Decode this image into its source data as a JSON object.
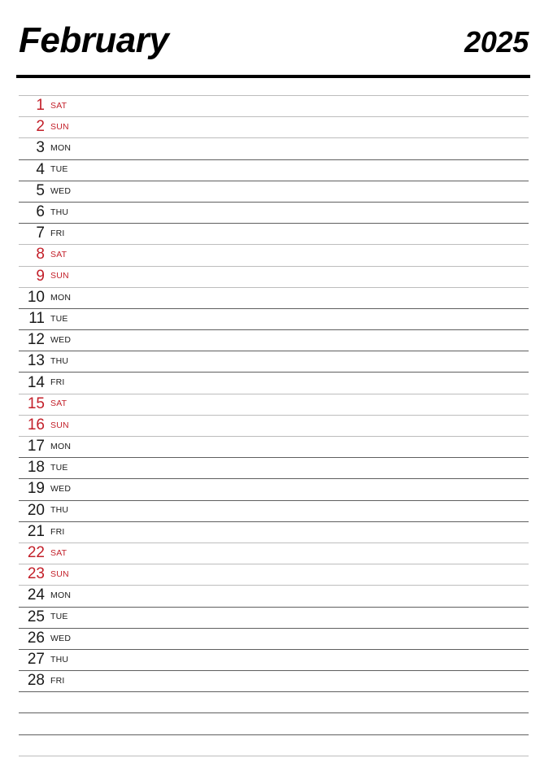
{
  "header": {
    "month": "February",
    "year": "2025"
  },
  "colors": {
    "weekend": "#c3202a",
    "weekday": "#1a1a1a",
    "rule_dark": "#5f5f5f",
    "rule_light": "#bdbdbd",
    "header_rule": "#000000",
    "background": "#ffffff"
  },
  "days": [
    {
      "num": "1",
      "abbr": "SAT",
      "weekend": true
    },
    {
      "num": "2",
      "abbr": "SUN",
      "weekend": true
    },
    {
      "num": "3",
      "abbr": "MON",
      "weekend": false
    },
    {
      "num": "4",
      "abbr": "TUE",
      "weekend": false
    },
    {
      "num": "5",
      "abbr": "WED",
      "weekend": false
    },
    {
      "num": "6",
      "abbr": "THU",
      "weekend": false
    },
    {
      "num": "7",
      "abbr": "FRI",
      "weekend": false
    },
    {
      "num": "8",
      "abbr": "SAT",
      "weekend": true
    },
    {
      "num": "9",
      "abbr": "SUN",
      "weekend": true
    },
    {
      "num": "10",
      "abbr": "MON",
      "weekend": false
    },
    {
      "num": "11",
      "abbr": "TUE",
      "weekend": false
    },
    {
      "num": "12",
      "abbr": "WED",
      "weekend": false
    },
    {
      "num": "13",
      "abbr": "THU",
      "weekend": false
    },
    {
      "num": "14",
      "abbr": "FRI",
      "weekend": false
    },
    {
      "num": "15",
      "abbr": "SAT",
      "weekend": true
    },
    {
      "num": "16",
      "abbr": "SUN",
      "weekend": true
    },
    {
      "num": "17",
      "abbr": "MON",
      "weekend": false
    },
    {
      "num": "18",
      "abbr": "TUE",
      "weekend": false
    },
    {
      "num": "19",
      "abbr": "WED",
      "weekend": false
    },
    {
      "num": "20",
      "abbr": "THU",
      "weekend": false
    },
    {
      "num": "21",
      "abbr": "FRI",
      "weekend": false
    },
    {
      "num": "22",
      "abbr": "SAT",
      "weekend": true
    },
    {
      "num": "23",
      "abbr": "SUN",
      "weekend": true
    },
    {
      "num": "24",
      "abbr": "MON",
      "weekend": false
    },
    {
      "num": "25",
      "abbr": "TUE",
      "weekend": false
    },
    {
      "num": "26",
      "abbr": "WED",
      "weekend": false
    },
    {
      "num": "27",
      "abbr": "THU",
      "weekend": false
    },
    {
      "num": "28",
      "abbr": "FRI",
      "weekend": false
    }
  ],
  "blank_lines": [
    {
      "light": false
    },
    {
      "light": false
    },
    {
      "light": true
    }
  ]
}
